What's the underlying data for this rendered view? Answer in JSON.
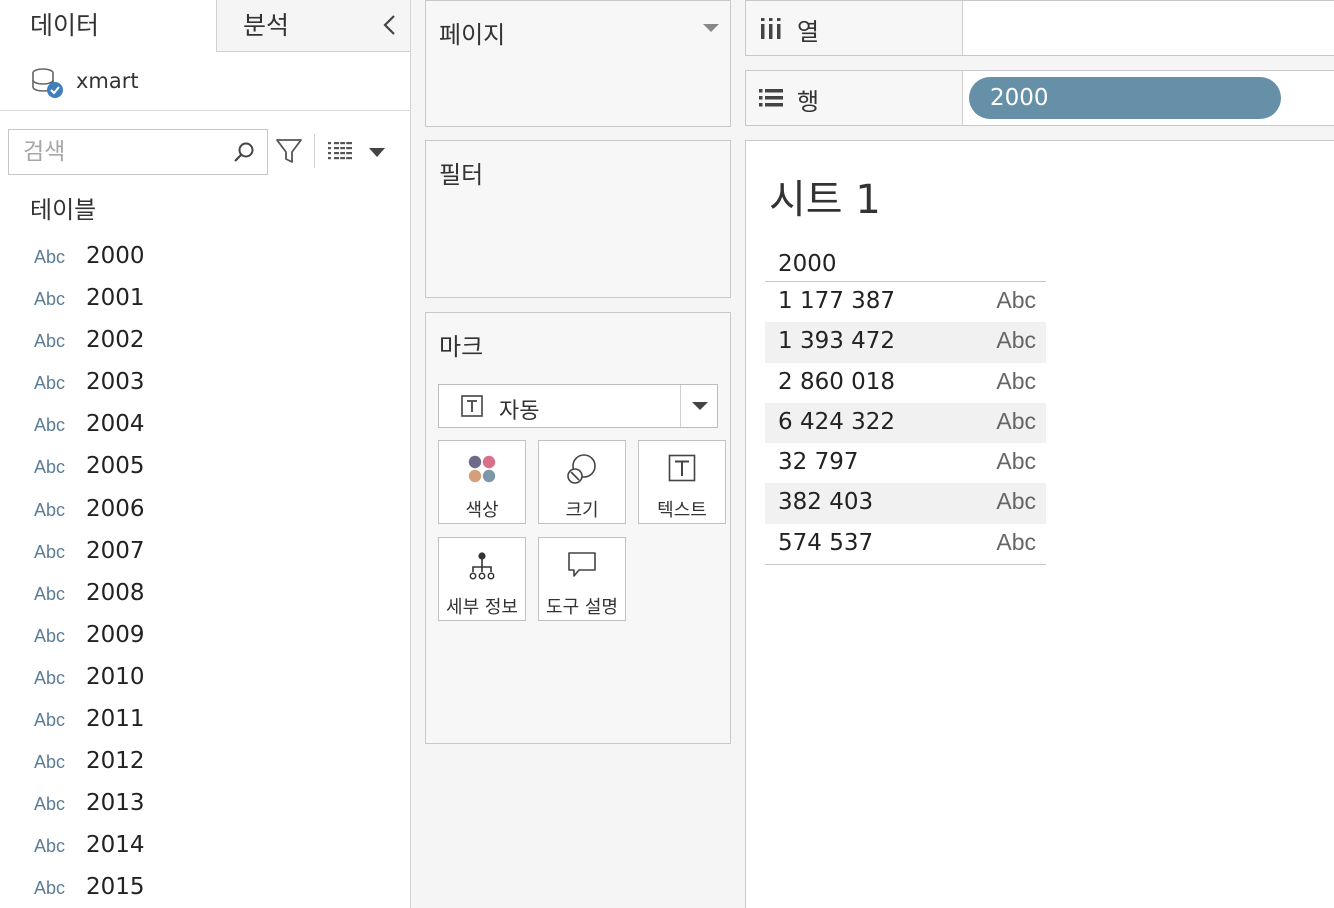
{
  "left_pane": {
    "tab_data": "데이터",
    "tab_analysis": "분석",
    "datasource": "xmart",
    "search_placeholder": "검색",
    "table_label": "테이블",
    "fields": [
      {
        "type": "Abc",
        "name": "2000"
      },
      {
        "type": "Abc",
        "name": "2001"
      },
      {
        "type": "Abc",
        "name": "2002"
      },
      {
        "type": "Abc",
        "name": "2003"
      },
      {
        "type": "Abc",
        "name": "2004"
      },
      {
        "type": "Abc",
        "name": "2005"
      },
      {
        "type": "Abc",
        "name": "2006"
      },
      {
        "type": "Abc",
        "name": "2007"
      },
      {
        "type": "Abc",
        "name": "2008"
      },
      {
        "type": "Abc",
        "name": "2009"
      },
      {
        "type": "Abc",
        "name": "2010"
      },
      {
        "type": "Abc",
        "name": "2011"
      },
      {
        "type": "Abc",
        "name": "2012"
      },
      {
        "type": "Abc",
        "name": "2013"
      },
      {
        "type": "Abc",
        "name": "2014"
      },
      {
        "type": "Abc",
        "name": "2015"
      }
    ]
  },
  "cards": {
    "pages_title": "페이지",
    "filters_title": "필터",
    "marks_title": "마크",
    "mark_type": "자동",
    "mark_buttons": {
      "color": "색상",
      "size": "크기",
      "text": "텍스트",
      "detail": "세부 정보",
      "tooltip": "도구 설명"
    }
  },
  "shelves": {
    "columns_label": "열",
    "rows_label": "행",
    "rows_pill": "2000"
  },
  "view": {
    "sheet_title": "시트 1",
    "header": "2000",
    "rows": [
      {
        "value": "1 177 387",
        "mark": "Abc"
      },
      {
        "value": "1 393 472",
        "mark": "Abc"
      },
      {
        "value": "2 860 018",
        "mark": "Abc"
      },
      {
        "value": "6 424 322",
        "mark": "Abc"
      },
      {
        "value": "32 797",
        "mark": "Abc"
      },
      {
        "value": "382 403",
        "mark": "Abc"
      },
      {
        "value": "574 537",
        "mark": "Abc"
      }
    ]
  },
  "colors": {
    "pill": "#6590a8",
    "abc_type": "#5b7c97",
    "color_dots": [
      "#6f6a8a",
      "#d9708a",
      "#d3a07a",
      "#7c98a8"
    ]
  }
}
